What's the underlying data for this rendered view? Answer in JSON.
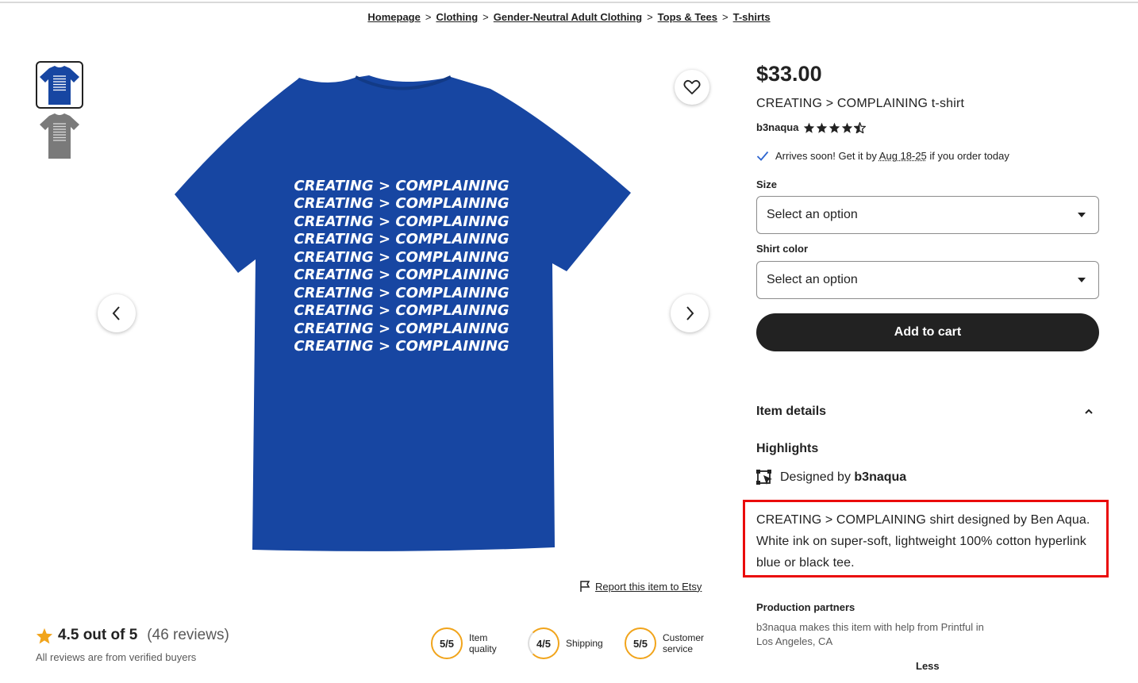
{
  "breadcrumb": {
    "items": [
      {
        "label": "Homepage"
      },
      {
        "label": "Clothing"
      },
      {
        "label": "Gender-Neutral Adult Clothing"
      },
      {
        "label": "Tops & Tees"
      },
      {
        "label": "T-shirts"
      }
    ],
    "separator": ">"
  },
  "gallery": {
    "thumbnails": [
      {
        "color": "#1746a2",
        "selected": true
      },
      {
        "color": "#7a7a7a",
        "selected": false
      }
    ],
    "main_image": {
      "shirt_color": "#1746a2",
      "print_text_left": "CREATING",
      "print_symbol": ">",
      "print_text_right": "COMPLAINING",
      "print_repeat": 10
    },
    "report_link": "Report this item to Etsy"
  },
  "product": {
    "price": "$33.00",
    "title": "CREATING > COMPLAINING t-shirt",
    "shop_name": "b3naqua",
    "shop_rating": 4.5,
    "arrival": {
      "prefix": "Arrives soon! Get it by",
      "dates": "Aug 18-25",
      "suffix": "if you order today"
    },
    "size_label": "Size",
    "size_value": "Select an option",
    "color_label": "Shirt color",
    "color_value": "Select an option",
    "add_to_cart": "Add to cart"
  },
  "details": {
    "heading": "Item details",
    "highlights_heading": "Highlights",
    "designed_prefix": "Designed by",
    "designed_by": "b3naqua",
    "description": "CREATING > COMPLAINING shirt designed by Ben Aqua. White ink on super-soft, lightweight 100% cotton hyperlink blue or black tee.",
    "production_heading": "Production partners",
    "production_text": "b3naqua makes this item with help from Printful in Los Angeles, CA",
    "less_label": "Less"
  },
  "reviews": {
    "rating_text": "4.5 out of 5",
    "count_text": "(46 reviews)",
    "verified_text": "All reviews are from verified buyers",
    "scores": [
      {
        "value": "5/5",
        "label_line1": "Item",
        "label_line2": "quality"
      },
      {
        "value": "4/5",
        "label_line1": "Shipping",
        "label_line2": ""
      },
      {
        "value": "5/5",
        "label_line1": "Customer",
        "label_line2": "service"
      }
    ]
  },
  "colors": {
    "accent_red": "#ea0b0b",
    "star_orange": "#f1a41b",
    "cart_button": "#222222",
    "check_blue": "#2f66d0"
  }
}
